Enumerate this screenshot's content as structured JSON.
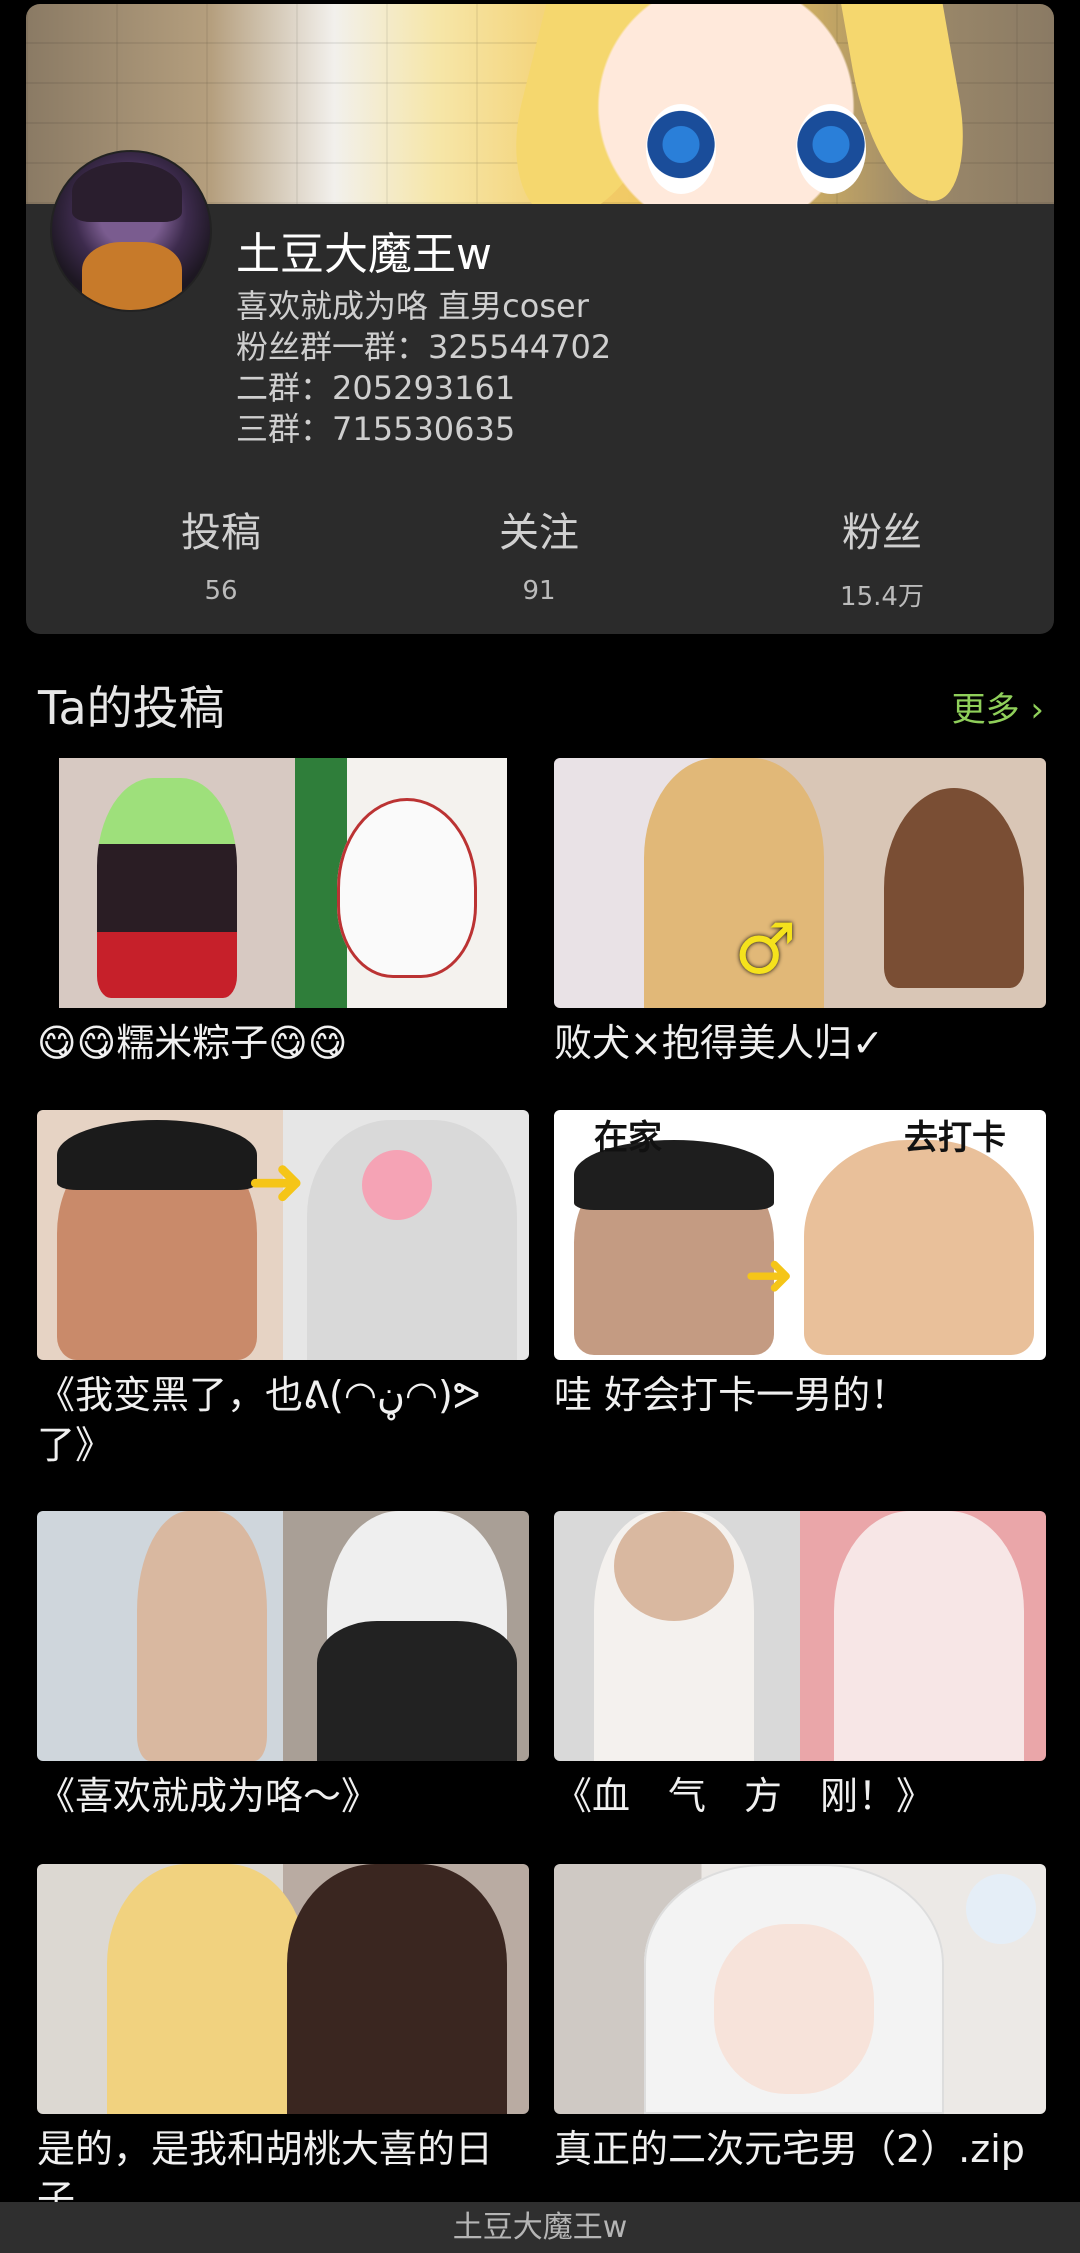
{
  "profile": {
    "name": "土豆大魔王w",
    "bio_lines": [
      "喜欢就成为咯 直男coser",
      "粉丝群一群：325544702",
      "二群：205293161",
      "三群：715530635"
    ]
  },
  "stats": [
    {
      "label": "投稿",
      "value": "56"
    },
    {
      "label": "关注",
      "value": "91"
    },
    {
      "label": "粉丝",
      "value": "15.4万"
    }
  ],
  "section": {
    "title": "Ta的投稿",
    "more": "更多 ›"
  },
  "posts": [
    {
      "title": "😋😋糯米粽子😋😋"
    },
    {
      "title": "败犬×抱得美人归✓",
      "thumb_symbol": "♂"
    },
    {
      "title": "《我变黑了，也ᕕ(◠ڼ◠)ᕗ了》"
    },
    {
      "title": "哇 好会打卡一男的！",
      "thumb_caption_left": "在家",
      "thumb_caption_right": "去打卡"
    },
    {
      "title": "《喜欢就成为咯～》"
    },
    {
      "title": "《血　气　方　刚！》"
    },
    {
      "title": "是的，是我和胡桃大喜的日子"
    },
    {
      "title": "真正的二次元宅男（2）.zip"
    }
  ],
  "bottom_bar": {
    "title": "土豆大魔王w"
  }
}
